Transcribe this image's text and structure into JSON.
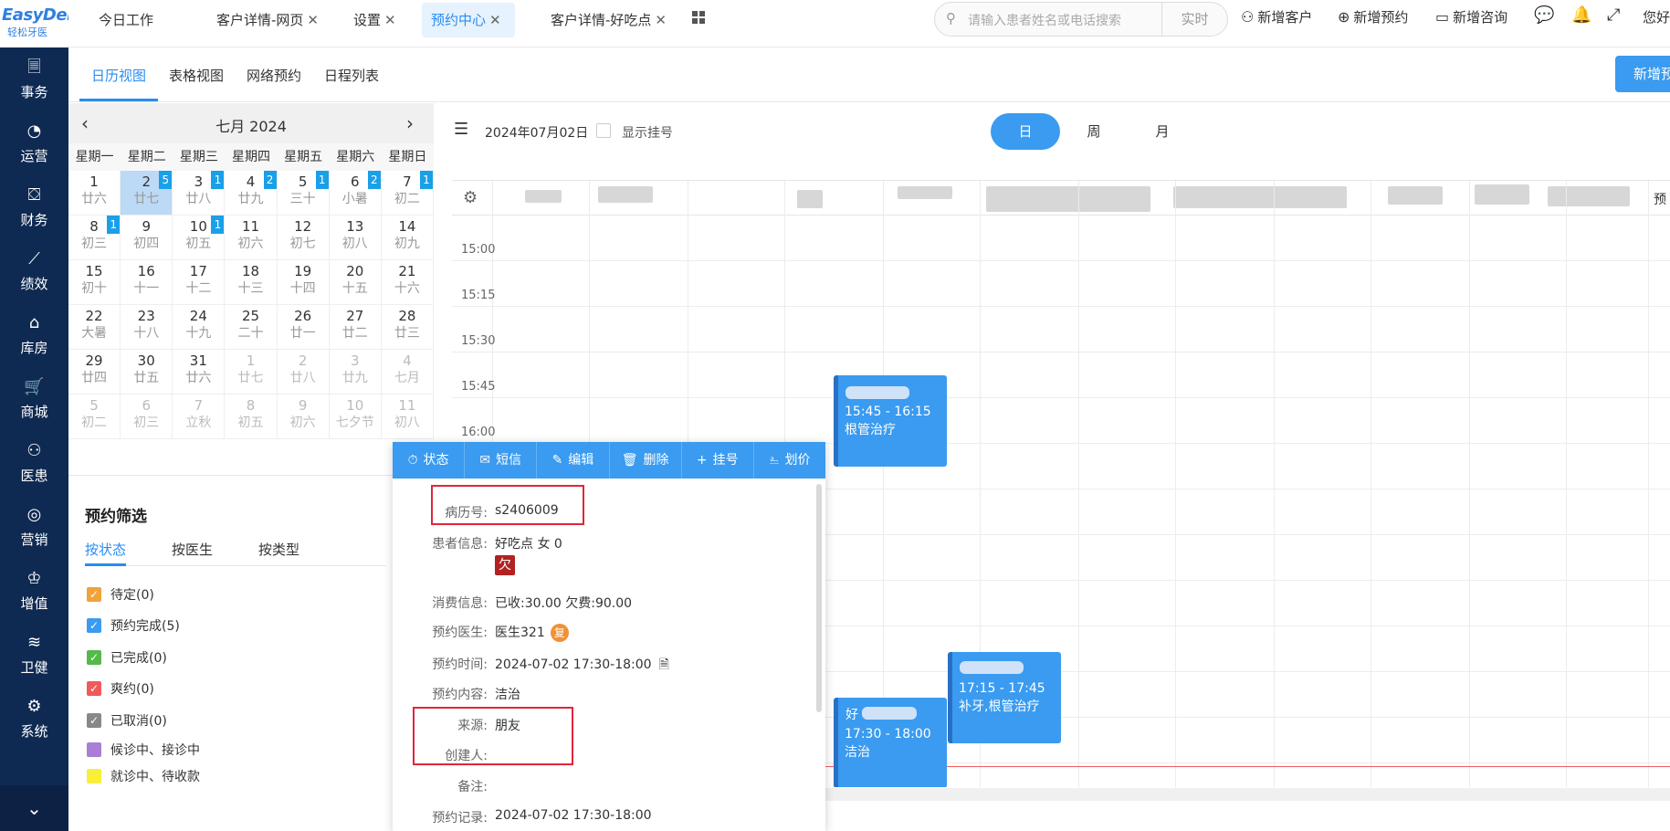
{
  "logo": {
    "brand": "EasyDent",
    "sub": "轻松牙医"
  },
  "nav": [
    {
      "label": "事务",
      "icon": "🗏"
    },
    {
      "label": "运营",
      "icon": "◔"
    },
    {
      "label": "财务",
      "icon": "⛋"
    },
    {
      "label": "绩效",
      "icon": "⟋"
    },
    {
      "label": "库房",
      "icon": "⌂"
    },
    {
      "label": "商城",
      "icon": "🛒"
    },
    {
      "label": "医患",
      "icon": "⚇"
    },
    {
      "label": "营销",
      "icon": "◎"
    },
    {
      "label": "增值",
      "icon": "♔"
    },
    {
      "label": "卫健",
      "icon": "≋"
    },
    {
      "label": "系统",
      "icon": "⚙"
    }
  ],
  "nav_bottom": "⌄",
  "tabs": [
    {
      "label": "今日工作",
      "closable": false
    },
    {
      "label": "客户详情-网页",
      "closable": true
    },
    {
      "label": "设置",
      "closable": true
    },
    {
      "label": "预约中心",
      "closable": true
    },
    {
      "label": "客户详情-好吃点",
      "closable": true
    }
  ],
  "close_glyph": "✕",
  "search": {
    "placeholder": "请输入患者姓名或电话搜索",
    "mode": "实时"
  },
  "top_actions": {
    "add_customer": "新增客户",
    "add_appointment": "新增预约",
    "add_consult": "新增咨询",
    "user": "您好"
  },
  "sub_tabs": [
    "日历视图",
    "表格视图",
    "网络预约",
    "日程列表"
  ],
  "new_appointment_btn": "新增预约",
  "calendar": {
    "title": "七月 2024",
    "weekdays": [
      "星期一",
      "星期二",
      "星期三",
      "星期四",
      "星期五",
      "星期六",
      "星期日"
    ],
    "days": [
      {
        "n": "1",
        "lu": "廿六",
        "badge": ""
      },
      {
        "n": "2",
        "lu": "廿七",
        "badge": "5",
        "sel": true
      },
      {
        "n": "3",
        "lu": "廿八",
        "badge": "1"
      },
      {
        "n": "4",
        "lu": "廿九",
        "badge": "2"
      },
      {
        "n": "5",
        "lu": "三十",
        "badge": "1"
      },
      {
        "n": "6",
        "lu": "小暑",
        "badge": "2"
      },
      {
        "n": "7",
        "lu": "初二",
        "badge": "1"
      },
      {
        "n": "8",
        "lu": "初三",
        "badge": "1"
      },
      {
        "n": "9",
        "lu": "初四",
        "badge": ""
      },
      {
        "n": "10",
        "lu": "初五",
        "badge": "1"
      },
      {
        "n": "11",
        "lu": "初六",
        "badge": ""
      },
      {
        "n": "12",
        "lu": "初七",
        "badge": ""
      },
      {
        "n": "13",
        "lu": "初八",
        "badge": ""
      },
      {
        "n": "14",
        "lu": "初九",
        "badge": ""
      },
      {
        "n": "15",
        "lu": "初十",
        "badge": ""
      },
      {
        "n": "16",
        "lu": "十一",
        "badge": ""
      },
      {
        "n": "17",
        "lu": "十二",
        "badge": ""
      },
      {
        "n": "18",
        "lu": "十三",
        "badge": ""
      },
      {
        "n": "19",
        "lu": "十四",
        "badge": ""
      },
      {
        "n": "20",
        "lu": "十五",
        "badge": ""
      },
      {
        "n": "21",
        "lu": "十六",
        "badge": ""
      },
      {
        "n": "22",
        "lu": "大暑",
        "badge": ""
      },
      {
        "n": "23",
        "lu": "十八",
        "badge": ""
      },
      {
        "n": "24",
        "lu": "十九",
        "badge": ""
      },
      {
        "n": "25",
        "lu": "二十",
        "badge": ""
      },
      {
        "n": "26",
        "lu": "廿一",
        "badge": ""
      },
      {
        "n": "27",
        "lu": "廿二",
        "badge": ""
      },
      {
        "n": "28",
        "lu": "廿三",
        "badge": ""
      },
      {
        "n": "29",
        "lu": "廿四",
        "badge": ""
      },
      {
        "n": "30",
        "lu": "廿五",
        "badge": ""
      },
      {
        "n": "31",
        "lu": "廿六",
        "badge": ""
      },
      {
        "n": "1",
        "lu": "廿七",
        "badge": "",
        "other": true
      },
      {
        "n": "2",
        "lu": "廿八",
        "badge": "",
        "other": true
      },
      {
        "n": "3",
        "lu": "廿九",
        "badge": "",
        "other": true
      },
      {
        "n": "4",
        "lu": "七月",
        "badge": "",
        "other": true
      },
      {
        "n": "5",
        "lu": "初二",
        "badge": "",
        "other": true
      },
      {
        "n": "6",
        "lu": "初三",
        "badge": "",
        "other": true
      },
      {
        "n": "7",
        "lu": "立秋",
        "badge": "",
        "other": true
      },
      {
        "n": "8",
        "lu": "初五",
        "badge": "",
        "other": true
      },
      {
        "n": "9",
        "lu": "初六",
        "badge": "",
        "other": true
      },
      {
        "n": "10",
        "lu": "七夕节",
        "badge": "",
        "other": true
      },
      {
        "n": "11",
        "lu": "初八",
        "badge": "",
        "other": true
      }
    ]
  },
  "filter": {
    "title": "预约筛选",
    "tabs": [
      "按状态",
      "按医生",
      "按类型"
    ],
    "items": [
      {
        "label": "待定(0)",
        "color": "#f0a23b",
        "checked": true
      },
      {
        "label": "预约完成(5)",
        "color": "#3a9bf0",
        "checked": true
      },
      {
        "label": "已完成(0)",
        "color": "#55b94a",
        "checked": true
      },
      {
        "label": "爽约(0)",
        "color": "#f05a5a",
        "checked": true
      },
      {
        "label": "已取消(0)",
        "color": "#888888",
        "checked": true
      },
      {
        "label": "候诊中、接诊中",
        "color": "#a97fd6",
        "checked": false
      },
      {
        "label": "就诊中、待收款",
        "color": "#f7ef3a",
        "checked": false
      }
    ]
  },
  "schedule": {
    "date": "2024年07月02日",
    "show_reg": "显示挂号",
    "views": [
      "日",
      "周",
      "月"
    ],
    "times": [
      "15:00",
      "15:15",
      "15:30",
      "15:45",
      "16:00"
    ],
    "right_edge_label": "预",
    "events": [
      {
        "time": "15:45 - 16:15",
        "content": "根管治疗"
      },
      {
        "time": "17:15 - 17:45",
        "content": "补牙,根管治疗"
      },
      {
        "time": "17:30 - 18:00",
        "content": "洁治",
        "name_fragment": "好"
      }
    ]
  },
  "popup": {
    "toolbar": [
      "状态",
      "短信",
      "编辑",
      "删除",
      "挂号",
      "划价"
    ],
    "toolbar_icons": [
      "⏱",
      "✉",
      "✎",
      "🗑",
      "+",
      "⎁"
    ],
    "record_no_label": "病历号:",
    "record_no": "s2406009",
    "patient_label": "患者信息:",
    "patient": "好吃点  女  0",
    "owe_tag": "欠",
    "consume_label": "消费信息:",
    "consume": "已收:30.00  欠费:90.00",
    "doctor_label": "预约医生:",
    "doctor": "医生321",
    "doctor_tag": "复",
    "time_label": "预约时间:",
    "time": "2024-07-02 17:30-18:00",
    "content_label": "预约内容:",
    "content": "洁治",
    "source_label": "来源:",
    "source": "朋友",
    "creator_label": "创建人:",
    "creator": "",
    "remark_label": "备注:",
    "remark": "",
    "log_label": "预约记录:",
    "log": "2024-07-02 17:30-18:00"
  }
}
